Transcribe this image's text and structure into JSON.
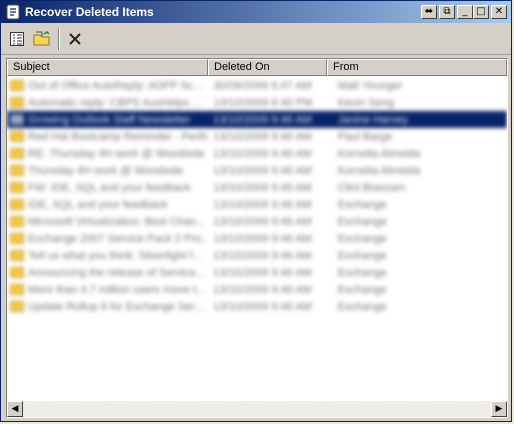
{
  "window": {
    "title": "Recover Deleted Items"
  },
  "titlebar_buttons": {
    "restore": "⬌",
    "help": "⧉",
    "minimize": "_",
    "maximize": "□",
    "close": "✕"
  },
  "toolbar": {
    "items": [
      "list-view-icon",
      "open-folder-icon",
      "delete-icon"
    ]
  },
  "columns": {
    "subject": "Subject",
    "deleted_on": "Deleted On",
    "from": "From"
  },
  "rows": [
    {
      "subject": "Out of Office AutoReply: ADFP Sc...",
      "deleted_on": "30/09/2009 6:47 AM",
      "from": "Matt Younger"
    },
    {
      "subject": "Automatic reply: CBPS AusHelps ...",
      "deleted_on": "13/10/2009 6:40 PM",
      "from": "Kevin Seng"
    },
    {
      "subject": "Growing Outlook Staff Newsletter",
      "deleted_on": "13/10/2009 9:46 AM",
      "from": "Janine Harvey"
    },
    {
      "subject": "Red Hat Bootcamp Reminder - Perth",
      "deleted_on": "13/10/2009 9:46 AM",
      "from": "Paul Barge"
    },
    {
      "subject": "RE: Thursday 4H work @ Woodside",
      "deleted_on": "13/10/2009 9:46 AM",
      "from": "Kornelia Almeida"
    },
    {
      "subject": "Thursday 4H work @ Woodside",
      "deleted_on": "13/10/2009 9:46 AM",
      "from": "Kornelia Almeida"
    },
    {
      "subject": "FW: IDE, SQL and your feedback",
      "deleted_on": "13/10/2009 9:46 AM",
      "from": "Clint Boessen"
    },
    {
      "subject": "IDE, SQL and your feedback",
      "deleted_on": "13/10/2009 9:46 AM",
      "from": "Exchange"
    },
    {
      "subject": "Microsoft Virtualization: Best Chan...",
      "deleted_on": "13/10/2009 9:46 AM",
      "from": "Exchange"
    },
    {
      "subject": "Exchange 2007 Service Pack 2 Pro...",
      "deleted_on": "13/10/2009 9:46 AM",
      "from": "Exchange"
    },
    {
      "subject": "Tell us what you think: Silverlight f...",
      "deleted_on": "13/10/2009 9:46 AM",
      "from": "Exchange"
    },
    {
      "subject": "Announcing the release of Service...",
      "deleted_on": "13/10/2009 9:46 AM",
      "from": "Exchange"
    },
    {
      "subject": "More than 4.7 million users move t...",
      "deleted_on": "13/10/2009 9:46 AM",
      "from": "Exchange"
    },
    {
      "subject": "Update Rollup 9 for Exchange Ser...",
      "deleted_on": "13/10/2009 9:46 AM",
      "from": "Exchange"
    }
  ],
  "selected_row": 2,
  "scrollbar": {
    "left": "◀",
    "right": "▶"
  }
}
